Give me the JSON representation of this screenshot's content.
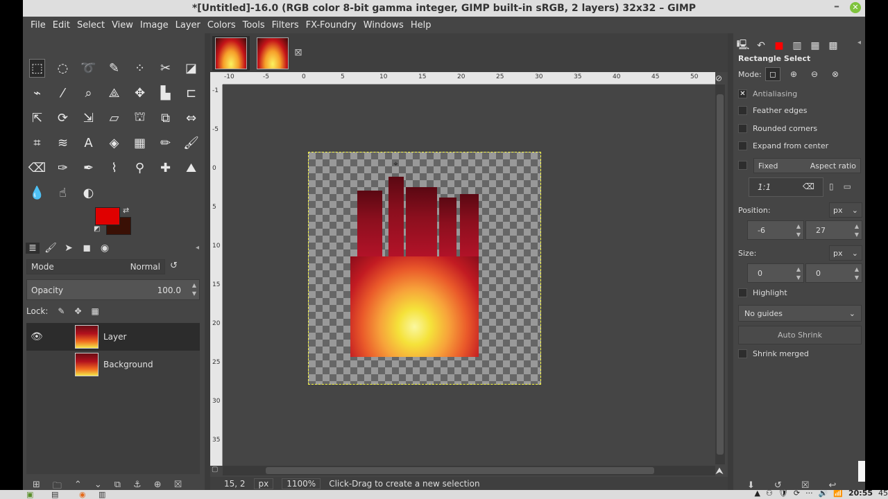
{
  "window": {
    "title": "*[Untitled]-16.0 (RGB color 8-bit gamma integer, GIMP built-in sRGB, 2 layers) 32x32 – GIMP",
    "minimize_glyph": "–",
    "close_glyph": "✕"
  },
  "menu": [
    "File",
    "Edit",
    "Select",
    "View",
    "Image",
    "Layer",
    "Colors",
    "Tools",
    "Filters",
    "FX-Foundry",
    "Windows",
    "Help"
  ],
  "toolbox": {
    "tools": [
      {
        "name": "rect-select-tool",
        "glyph": "⬚"
      },
      {
        "name": "ellipse-select-tool",
        "glyph": "◌"
      },
      {
        "name": "free-select-tool",
        "glyph": "➰"
      },
      {
        "name": "fuzzy-select-tool",
        "glyph": "✎"
      },
      {
        "name": "select-by-color-tool",
        "glyph": "⁘"
      },
      {
        "name": "scissors-select-tool",
        "glyph": "✂"
      },
      {
        "name": "foreground-select-tool",
        "glyph": "◪"
      },
      {
        "name": "paths-tool",
        "glyph": "⌁"
      },
      {
        "name": "color-picker-tool",
        "glyph": "⁄"
      },
      {
        "name": "zoom-tool",
        "glyph": "⌕"
      },
      {
        "name": "measure-tool",
        "glyph": "⟁"
      },
      {
        "name": "move-tool",
        "glyph": "✥"
      },
      {
        "name": "align-tool",
        "glyph": "▙"
      },
      {
        "name": "crop-tool",
        "glyph": "⊏"
      },
      {
        "name": "unified-transform-tool",
        "glyph": "⇱"
      },
      {
        "name": "rotate-tool",
        "glyph": "⟳"
      },
      {
        "name": "scale-tool",
        "glyph": "⇲"
      },
      {
        "name": "shear-tool",
        "glyph": "▱"
      },
      {
        "name": "handle-transform-tool",
        "glyph": "⛫"
      },
      {
        "name": "perspective-tool",
        "glyph": "⧉"
      },
      {
        "name": "flip-tool",
        "glyph": "⇔"
      },
      {
        "name": "cage-transform-tool",
        "glyph": "⌗"
      },
      {
        "name": "warp-transform-tool",
        "glyph": "≋"
      },
      {
        "name": "text-tool",
        "glyph": "A"
      },
      {
        "name": "bucket-fill-tool",
        "glyph": "◈"
      },
      {
        "name": "gradient-tool",
        "glyph": "▦"
      },
      {
        "name": "pencil-tool",
        "glyph": "✏"
      },
      {
        "name": "paintbrush-tool",
        "glyph": "🖌"
      },
      {
        "name": "eraser-tool",
        "glyph": "⌫"
      },
      {
        "name": "airbrush-tool",
        "glyph": "✑"
      },
      {
        "name": "ink-tool",
        "glyph": "✒"
      },
      {
        "name": "mypaint-brush-tool",
        "glyph": "⌇"
      },
      {
        "name": "clone-tool",
        "glyph": "⚲"
      },
      {
        "name": "heal-tool",
        "glyph": "✚"
      },
      {
        "name": "perspective-clone-tool",
        "glyph": "⛰"
      },
      {
        "name": "blur-sharpen-tool",
        "glyph": "💧"
      },
      {
        "name": "smudge-tool",
        "glyph": "☝"
      },
      {
        "name": "dodge-burn-tool",
        "glyph": "◐"
      }
    ],
    "fg_color": "#e00000",
    "bg_color": "#3a1005",
    "swap_glyph": "⇄",
    "reset_glyph": "◩"
  },
  "layers_panel": {
    "tabs": [
      "≣",
      "🖌",
      "➤",
      "◼",
      "◉"
    ],
    "mode_label": "Mode",
    "mode_value": "Normal",
    "opacity_label": "Opacity",
    "opacity_value": "100.0",
    "lock_label": "Lock:",
    "lock_icons": [
      "✎",
      "✥",
      "▦"
    ],
    "layers": [
      {
        "name": "Layer",
        "visible": true,
        "active": true
      },
      {
        "name": "Background",
        "visible": false,
        "active": false
      }
    ],
    "eye_glyph": "👁",
    "bottom_buttons": [
      "⊞",
      "🗀",
      "⌃",
      "⌄",
      "⧉",
      "⚓",
      "⊕",
      "☒"
    ]
  },
  "image_tabs": {
    "close_glyph": "⊠"
  },
  "rulers": {
    "h_labels": [
      "-10",
      "-5",
      "0",
      "5",
      "10",
      "15",
      "20",
      "25",
      "30",
      "35",
      "40",
      "45",
      "50"
    ],
    "v_labels": [
      "-1",
      "-5",
      "0",
      "5",
      "10",
      "15",
      "20",
      "25",
      "30",
      "35"
    ]
  },
  "statusbar": {
    "coords": "15, 2",
    "unit": "px",
    "zoom": "1100%",
    "message": "Click-Drag to create a new selection"
  },
  "tool_options": {
    "tabs": [
      "🖳",
      "↶",
      "■",
      "▥",
      "▦",
      "▩"
    ],
    "title": "Rectangle Select",
    "mode_label": "Mode:",
    "mode_icons": [
      "◻",
      "⊕",
      "⊖",
      "⊗"
    ],
    "antialiasing": {
      "label": "Antialiasing",
      "checked": true
    },
    "feather": {
      "label": "Feather edges",
      "checked": false
    },
    "rounded": {
      "label": "Rounded corners",
      "checked": false
    },
    "expand": {
      "label": "Expand from center",
      "checked": false
    },
    "fixed": {
      "label": "Fixed",
      "value": "Aspect ratio",
      "checked": false
    },
    "ratio": "1:1",
    "position_label": "Position:",
    "position_unit": "px",
    "position_x": "-6",
    "position_y": "27",
    "size_label": "Size:",
    "size_unit": "px",
    "size_w": "0",
    "size_h": "0",
    "highlight": {
      "label": "Highlight",
      "checked": false
    },
    "guides": "No guides",
    "auto_shrink": "Auto Shrink",
    "shrink_merged": {
      "label": "Shrink merged",
      "checked": false
    },
    "bottom_buttons": [
      "⬇",
      "↺",
      "☒",
      "↩"
    ]
  },
  "taskbar": {
    "clock": "20:55",
    "battery": "45",
    "tray_icons": [
      "▲",
      "⚇",
      "🛡",
      "⟳",
      "···",
      "🔊",
      "📶"
    ]
  }
}
